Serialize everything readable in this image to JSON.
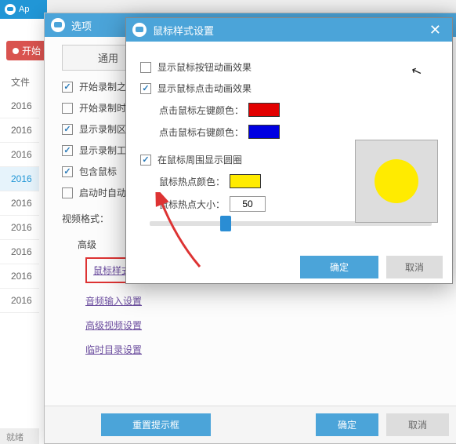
{
  "app": {
    "title": "Ap",
    "record_label": "开始",
    "file_label": "文件",
    "status": "就绪",
    "sidebar_items": [
      "2016",
      "2016",
      "2016",
      "2016",
      "2016",
      "2016",
      "2016",
      "2016",
      "2016"
    ],
    "active_index": 3
  },
  "options": {
    "title": "选项",
    "tab_general": "通用",
    "checks": {
      "c1": "开始录制之",
      "c2": "开始录制时",
      "c3": "显示录制区",
      "c4": "显示录制工",
      "c5": "包含鼠标",
      "c6": "启动时自动"
    },
    "video_format_label": "视频格式：",
    "advanced_label": "高级",
    "links": {
      "mouse": "鼠标样式设置",
      "audio": "音频输入设置",
      "adv_video": "高级视频设置",
      "temp": "临时目录设置"
    },
    "reset_label": "重置提示框",
    "ok_label": "确定",
    "cancel_label": "取消"
  },
  "mouse": {
    "title": "鼠标样式设置",
    "show_button_anim": "显示鼠标按钮动画效果",
    "show_click_anim": "显示鼠标点击动画效果",
    "left_color_label": "点击鼠标左键颜色：",
    "right_color_label": "点击鼠标右键颜色：",
    "left_color": "#e20000",
    "right_color": "#0000e2",
    "show_circle": "在鼠标周围显示圆圈",
    "hotspot_color_label": "鼠标热点颜色：",
    "hotspot_color": "#ffeb00",
    "hotspot_size_label": "鼠标热点大小：",
    "hotspot_size": "50",
    "ok_label": "确定",
    "cancel_label": "取消"
  }
}
